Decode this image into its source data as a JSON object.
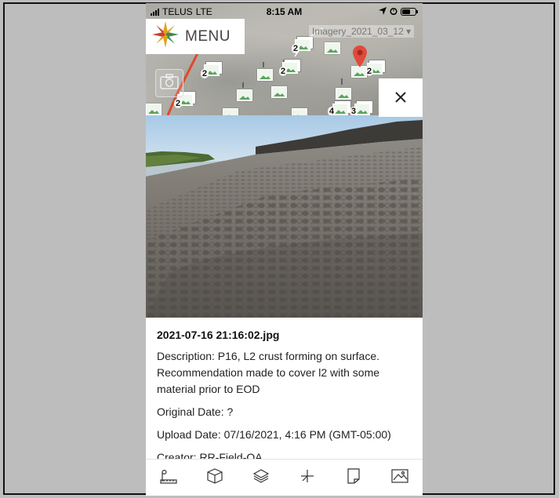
{
  "status_bar": {
    "carrier": "TELUS",
    "network": "LTE",
    "time": "8:15 AM"
  },
  "map": {
    "menu_label": "MENU",
    "layer_selector": "Imagery_2021_03_12 ▾",
    "cluster_counts": [
      "2",
      "2",
      "2",
      "2",
      "2",
      "2",
      "4",
      "3"
    ],
    "close_icon": "close-icon",
    "camera_icon": "camera-icon",
    "location_pin": "location-pin-icon"
  },
  "photo": {
    "subject": "mud field with tracks"
  },
  "details": {
    "file_name": "2021-07-16 21:16:02.jpg",
    "description": "Description: P16, L2 crust forming on surface. Recommendation made to cover l2 with some material prior to EOD",
    "original_date": "Original Date: ?",
    "upload_date": "Upload Date: 07/16/2021, 4:16 PM (GMT-05:00)",
    "creator": "Creator: RR-Field-QA"
  },
  "toolbar": {
    "items": [
      {
        "icon": "measure-ruler-icon"
      },
      {
        "icon": "cube-icon"
      },
      {
        "icon": "layers-icon"
      },
      {
        "icon": "crosshair-icon"
      },
      {
        "icon": "note-icon"
      },
      {
        "icon": "image-icon"
      }
    ]
  },
  "colors": {
    "pin_red": "#e04a3a",
    "track_red": "#e0482c",
    "thumb_green": "#5aa45a",
    "logo_gold": "#e0a31f",
    "logo_green": "#3f8a4d",
    "logo_red": "#c9412f"
  }
}
